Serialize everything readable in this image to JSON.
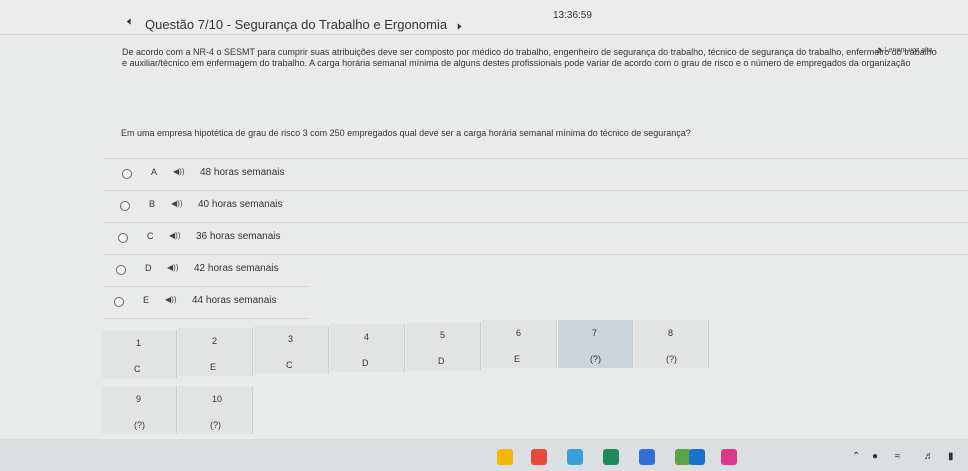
{
  "header": {
    "timer": "13:36:59",
    "title": "Questão 7/10 - Segurança do Trabalho e Ergonomia"
  },
  "tts_label": "Ler em voz alta",
  "statement": "De acordo com a NR-4 o SESMT para cumprir suas atribuições deve ser composto por médico do trabalho, engenheiro de segurança do trabalho, técnico de segurança do trabalho, enfermeiro do trabalho e auxiliar/técnico em enfermagem do trabalho. A carga horária semanal mínima de alguns destes profissionais pode variar de acordo com o grau de risco e o número de empregados da organização",
  "question": "Em uma empresa hipotética de grau de risco 3 com 250 empregados qual deve ser a carga horária semanal mínima do técnico de segurança?",
  "options": [
    {
      "letter": "A",
      "text": "48 horas semanais"
    },
    {
      "letter": "B",
      "text": "40 horas semanais"
    },
    {
      "letter": "C",
      "text": "36 horas semanais"
    },
    {
      "letter": "D",
      "text": "42 horas semanais"
    },
    {
      "letter": "E",
      "text": "44 horas semanais"
    }
  ],
  "nav": [
    {
      "num": "1",
      "answer": "C"
    },
    {
      "num": "2",
      "answer": "E"
    },
    {
      "num": "3",
      "answer": "C"
    },
    {
      "num": "4",
      "answer": "D"
    },
    {
      "num": "5",
      "answer": "D"
    },
    {
      "num": "6",
      "answer": "E"
    },
    {
      "num": "7",
      "answer": "(?)"
    },
    {
      "num": "8",
      "answer": "(?)"
    },
    {
      "num": "9",
      "answer": "(?)"
    },
    {
      "num": "10",
      "answer": "(?)"
    }
  ],
  "taskbar": {
    "apps": [
      "files-icon",
      "chrome-icon",
      "photos-icon",
      "store-icon",
      "maps-icon",
      "lens-icon",
      "dropbox-icon",
      "instagram-icon"
    ],
    "colors": [
      "#f2b707",
      "#e5483c",
      "#39a0d8",
      "#1d8a5c",
      "#2f6fd6",
      "#5fa04a",
      "#1a72c9",
      "#d83a8b"
    ]
  }
}
